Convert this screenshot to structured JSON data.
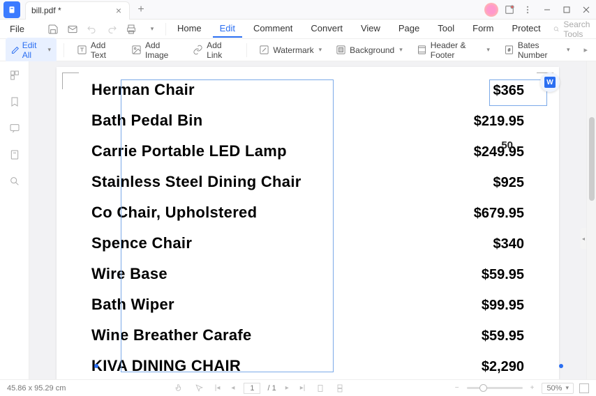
{
  "titlebar": {
    "tab_title": "bill.pdf *"
  },
  "menubar": {
    "file": "File",
    "tabs": [
      "Home",
      "Edit",
      "Comment",
      "Convert",
      "View",
      "Page",
      "Tool",
      "Form",
      "Protect"
    ],
    "active_tab": 1,
    "search_placeholder": "Search Tools"
  },
  "toolbar": {
    "edit_all": "Edit All",
    "add_text": "Add Text",
    "add_image": "Add Image",
    "add_link": "Add Link",
    "watermark": "Watermark",
    "background": "Background",
    "header_footer": "Header & Footer",
    "bates_number": "Bates Number"
  },
  "document": {
    "rows": [
      {
        "item": "Herman Chair",
        "price": "$365"
      },
      {
        "item": "Bath Pedal Bin",
        "price": "$219.95"
      },
      {
        "item": "Carrie Portable LED Lamp",
        "price": "$249.95",
        "overlay": "50"
      },
      {
        "item": "Stainless Steel Dining Chair",
        "price": "$925"
      },
      {
        "item": "Co Chair, Upholstered",
        "price": "$679.95"
      },
      {
        "item": "Spence Chair",
        "price": "$340"
      },
      {
        "item": "Wire Base",
        "price": "$59.95"
      },
      {
        "item": "Bath Wiper",
        "price": "$99.95"
      },
      {
        "item": "Wine Breather Carafe",
        "price": "$59.95"
      },
      {
        "item": "KIVA DINING CHAIR",
        "price": "$2,290"
      }
    ],
    "word_badge": "W"
  },
  "statusbar": {
    "dimensions": "45.86 x 95.29 cm",
    "page_current": "1",
    "page_total": "/ 1",
    "zoom": "50%"
  }
}
